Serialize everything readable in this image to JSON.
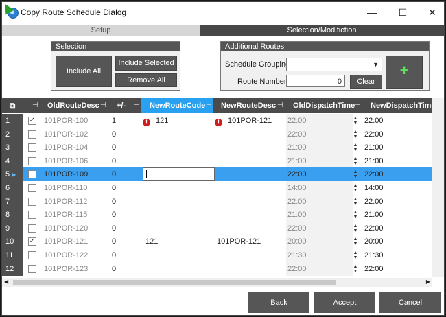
{
  "window": {
    "title": "Copy Route Schedule Dialog"
  },
  "titlebar_buttons": {
    "minimize": "—",
    "maximize": "☐",
    "close": "✕"
  },
  "tabs": [
    {
      "label": "Setup"
    },
    {
      "label": "Selection/Modifiction"
    }
  ],
  "selection": {
    "title": "Selection",
    "include_all": "Include All",
    "include_selected": "Include Selected",
    "remove_all": "Remove All"
  },
  "additional_routes": {
    "title": "Additional Routes",
    "schedule_grouping_label": "Schedule Grouping",
    "schedule_grouping_value": "",
    "route_number_label": "Route Number",
    "route_number_value": "0",
    "clear_label": "Clear",
    "add_label": "+"
  },
  "grid": {
    "columns": {
      "old_route_desc": "OldRouteDesc",
      "plus_minus": "+/-",
      "new_route_code": "NewRouteCode",
      "new_route_desc": "NewRouteDesc",
      "old_dispatch_time": "OldDispatchTime",
      "new_dispatch_time": "NewDispatchTime"
    },
    "rows": [
      {
        "num": "1",
        "checked": "✓",
        "old_desc": "101POR-100",
        "delta": "1",
        "new_code": "121",
        "new_desc": "101POR-121",
        "old_time": "22:00",
        "new_time": "22:00",
        "error": "!"
      },
      {
        "num": "2",
        "checked": "",
        "old_desc": "101POR-102",
        "delta": "0",
        "new_code": "",
        "new_desc": "",
        "old_time": "22:00",
        "new_time": "22:00",
        "error": ""
      },
      {
        "num": "3",
        "checked": "",
        "old_desc": "101POR-104",
        "delta": "0",
        "new_code": "",
        "new_desc": "",
        "old_time": "21:00",
        "new_time": "21:00",
        "error": ""
      },
      {
        "num": "4",
        "checked": "",
        "old_desc": "101POR-106",
        "delta": "0",
        "new_code": "",
        "new_desc": "",
        "old_time": "21:00",
        "new_time": "21:00",
        "error": ""
      },
      {
        "num": "5",
        "checked": "",
        "old_desc": "101POR-109",
        "delta": "0",
        "new_code": "",
        "new_desc": "",
        "old_time": "22:00",
        "new_time": "22:00",
        "error": "",
        "indicator": "▶"
      },
      {
        "num": "6",
        "checked": "",
        "old_desc": "101POR-110",
        "delta": "0",
        "new_code": "",
        "new_desc": "",
        "old_time": "14:00",
        "new_time": "14:00",
        "error": ""
      },
      {
        "num": "7",
        "checked": "",
        "old_desc": "101POR-112",
        "delta": "0",
        "new_code": "",
        "new_desc": "",
        "old_time": "22:00",
        "new_time": "22:00",
        "error": ""
      },
      {
        "num": "8",
        "checked": "",
        "old_desc": "101POR-115",
        "delta": "0",
        "new_code": "",
        "new_desc": "",
        "old_time": "21:00",
        "new_time": "21:00",
        "error": ""
      },
      {
        "num": "9",
        "checked": "",
        "old_desc": "101POR-120",
        "delta": "0",
        "new_code": "",
        "new_desc": "",
        "old_time": "22:00",
        "new_time": "22:00",
        "error": ""
      },
      {
        "num": "10",
        "checked": "✓",
        "old_desc": "101POR-121",
        "delta": "0",
        "new_code": "121",
        "new_desc": "101POR-121",
        "old_time": "20:00",
        "new_time": "20:00",
        "error": ""
      },
      {
        "num": "11",
        "checked": "",
        "old_desc": "101POR-122",
        "delta": "0",
        "new_code": "",
        "new_desc": "",
        "old_time": "21:30",
        "new_time": "21:30",
        "error": ""
      },
      {
        "num": "12",
        "checked": "",
        "old_desc": "101POR-123",
        "delta": "0",
        "new_code": "",
        "new_desc": "",
        "old_time": "22:00",
        "new_time": "22:00",
        "error": ""
      }
    ]
  },
  "footer": {
    "back": "Back",
    "accept": "Accept",
    "cancel": "Cancel"
  },
  "colors": {
    "accent": "#29a0f0",
    "selected_row": "#3b9ff0",
    "dark": "#565656",
    "error": "#d01c1c",
    "add_plus": "#5ee05e"
  }
}
